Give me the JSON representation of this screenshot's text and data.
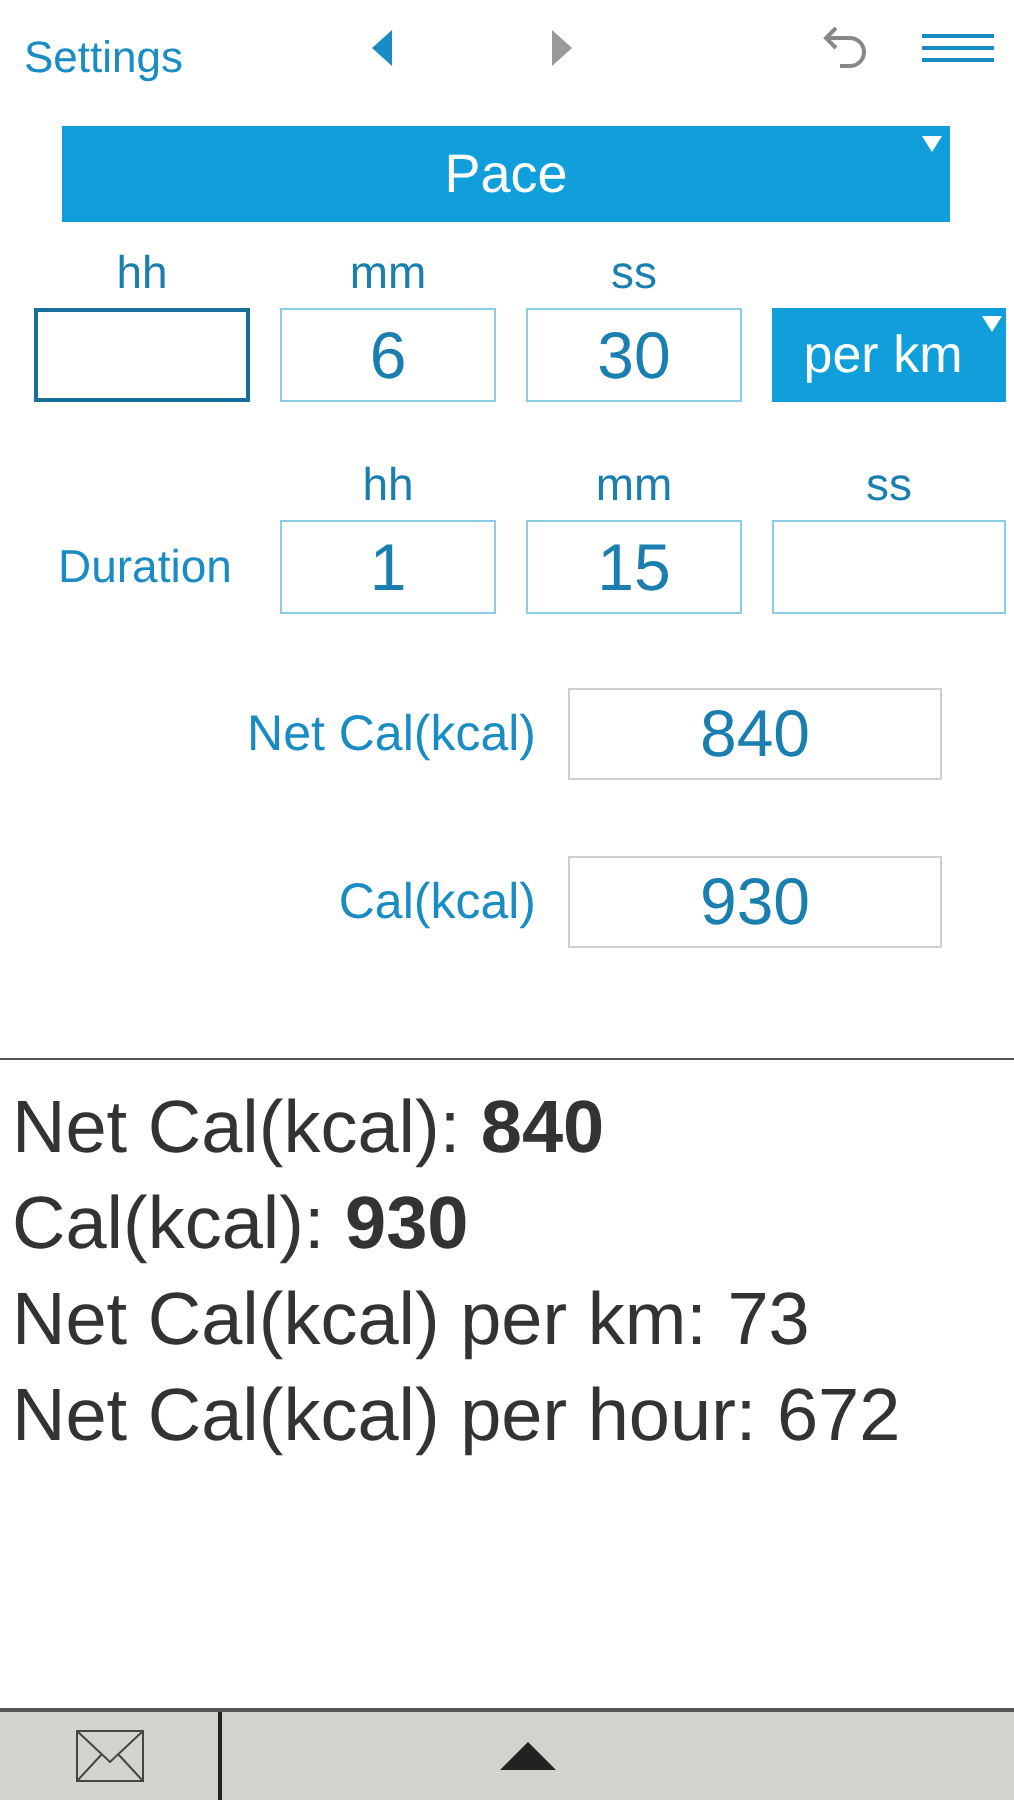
{
  "toolbar": {
    "settings": "Settings",
    "prev": {
      "disabled": false
    },
    "next": {
      "disabled": true
    }
  },
  "mode_dropdown": {
    "value": "Pace"
  },
  "pace": {
    "columns": [
      "hh",
      "mm",
      "ss"
    ],
    "fields": [
      {
        "focused": true
      },
      {
        "value": "6",
        "focused": false
      },
      {
        "value": "30",
        "focused": false
      }
    ],
    "unit_dropdown": {
      "value": "per km"
    }
  },
  "duration": {
    "label": "Duration",
    "columns": [
      "hh",
      "mm",
      "ss"
    ],
    "fields": [
      {
        "value": "1",
        "focused": false
      },
      {
        "value": "15",
        "focused": false
      },
      {
        "focused": false
      }
    ]
  },
  "outputs": [
    {
      "label": "Net Cal(kcal)",
      "value": "840"
    },
    {
      "label": "Cal(kcal)",
      "value": "930"
    }
  ],
  "results": [
    "Net Cal(kcal): **840**",
    "Cal(kcal): **930**",
    "Net Cal(kcal) per km: 73",
    "Net Cal(kcal) per hour: 672"
  ]
}
